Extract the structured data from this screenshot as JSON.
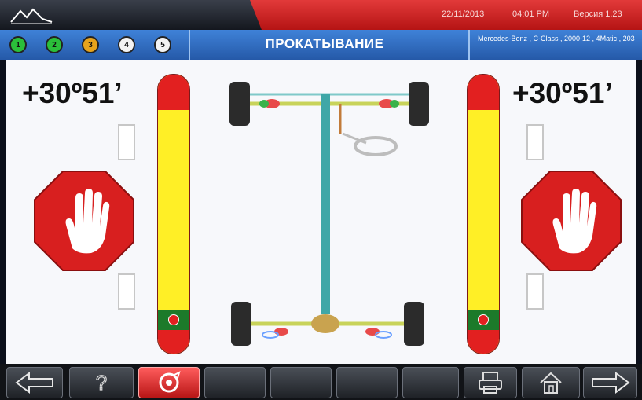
{
  "header": {
    "date": "22/11/2013",
    "time": "04:01 PM",
    "version_label": "Версия 1.23"
  },
  "steps": [
    {
      "label": "1",
      "state": "done"
    },
    {
      "label": "2",
      "state": "done"
    },
    {
      "label": "3",
      "state": "current"
    },
    {
      "label": "4",
      "state": "pending"
    },
    {
      "label": "5",
      "state": "pending"
    }
  ],
  "title": "ПРОКАТЫВАНИЕ",
  "vehicle": "Mercedes-Benz , C-Class , 2000-12 , 4Matic , 203",
  "left": {
    "angle": "+30º51’"
  },
  "right": {
    "angle": "+30º51’"
  },
  "colors": {
    "stop_red": "#d81f1f",
    "gauge_yellow": "#ffef26",
    "gauge_red": "#e22020",
    "gauge_green": "#1c7a2a",
    "header_blue": "#2f6fc6"
  },
  "toolbar": {
    "buttons": [
      {
        "icon": "arrow-left-icon"
      },
      {
        "icon": "help-icon"
      },
      {
        "icon": "runout-icon",
        "active": true
      },
      {
        "icon": "blank"
      },
      {
        "icon": "blank"
      },
      {
        "icon": "blank"
      },
      {
        "icon": "blank"
      },
      {
        "icon": "printer-icon"
      },
      {
        "icon": "home-icon"
      },
      {
        "icon": "arrow-right-icon"
      }
    ]
  }
}
